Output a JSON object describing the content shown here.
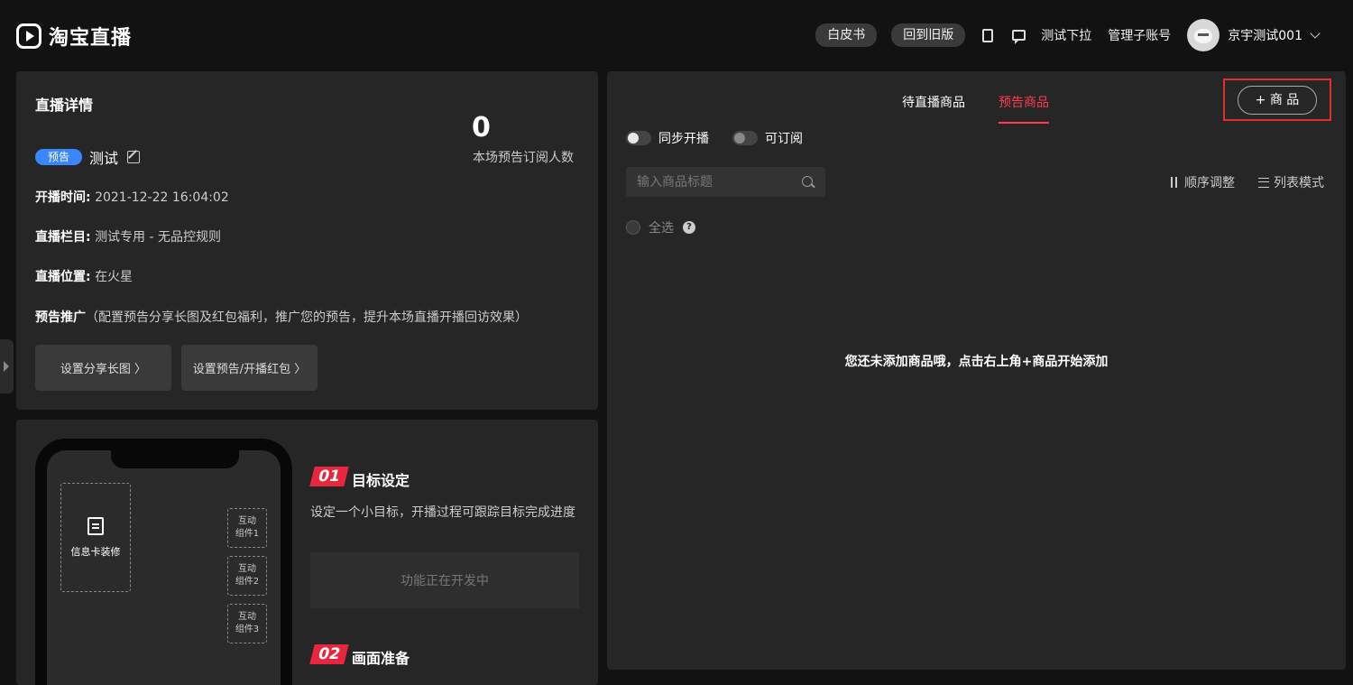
{
  "header": {
    "logo_text": "淘宝直播",
    "whitebook": "白皮书",
    "old_version": "回到旧版",
    "test_dropdown": "测试下拉",
    "sub_accounts": "管理子账号",
    "user_name": "京宇测试001"
  },
  "detail": {
    "title": "直播详情",
    "badge": "预告",
    "live_name": "测试",
    "sub_count": "0",
    "sub_label": "本场预告订阅人数",
    "start_key": "开播时间:",
    "start_val": "2021-12-22 16:04:02",
    "column_key": "直播栏目:",
    "column_val": "测试专用 - 无品控规则",
    "location_key": "直播位置:",
    "location_val": "在火星",
    "promo_key": "预告推广",
    "promo_desc": "（配置预告分享长图及红包福利，推广您的预告，提升本场直播开播回访效果）",
    "btn_share": "设置分享长图 〉",
    "btn_redpacket": "设置预告/开播红包 〉"
  },
  "goal": {
    "infocard": "信息卡装修",
    "comp1_line1": "互动",
    "comp1_line2": "组件1",
    "comp2_line1": "互动",
    "comp2_line2": "组件2",
    "comp3_line1": "互动",
    "comp3_line2": "组件3",
    "step1_no": "01",
    "step1_title": "目标设定",
    "step1_desc": "设定一个小目标，开播过程可跟踪目标完成进度",
    "dev_text": "功能正在开发中",
    "step2_no": "02",
    "step2_title": "画面准备"
  },
  "products": {
    "tab_pending": "待直播商品",
    "tab_preview": "预告商品",
    "add_btn": "+ 商 品",
    "sync_label": "同步开播",
    "subscribe_label": "可订阅",
    "search_placeholder": "输入商品标题",
    "sort_label": "顺序调整",
    "list_label": "列表模式",
    "select_all": "全选",
    "help": "?",
    "empty": "您还未添加商品哦，点击右上角+商品开始添加"
  },
  "colors": {
    "accent_red": "#ff3b4f",
    "badge_blue": "#3a86ff",
    "highlight_border": "#e0302c"
  }
}
